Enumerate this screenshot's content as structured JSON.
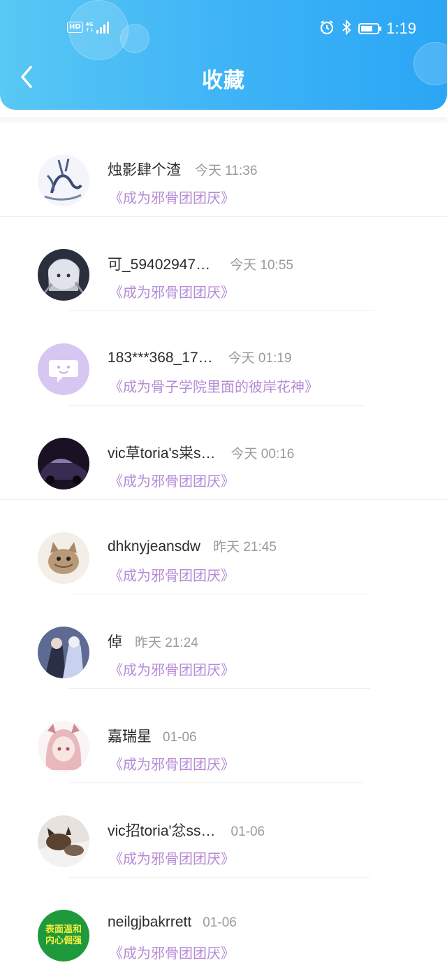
{
  "status_bar": {
    "hd": "HD",
    "network": "4G",
    "time": "1:19",
    "battery_level": 0.7,
    "icons": [
      "alarm-icon",
      "bluetooth-icon",
      "battery-icon"
    ]
  },
  "header": {
    "title": "收藏",
    "back_icon": "chevron-left-icon"
  },
  "colors": {
    "header_start": "#58c8f4",
    "header_end": "#2aa6f5",
    "book_title": "#b48ad6",
    "name": "#2b2b2b",
    "time": "#9a9a9a"
  },
  "favorites": [
    {
      "name": "烛影肆个渣",
      "time": "今天 11:36",
      "book": "《成为邪骨团团厌》",
      "avatar": "sketch-avatar"
    },
    {
      "name": "可_59402947…",
      "time": "今天 10:55",
      "book": "《成为邪骨团团厌》",
      "avatar": "anime-girl-avatar"
    },
    {
      "name": "183***368_17…",
      "time": "今天 01:19",
      "book": "《成为骨子学院里面的彼岸花神》",
      "avatar": "default-chat-avatar"
    },
    {
      "name": "vic草toria's粜s…",
      "time": "今天 00:16",
      "book": "《成为邪骨团团厌》",
      "avatar": "car-avatar"
    },
    {
      "name": "dhknyjeansdw",
      "time": "昨天 21:45",
      "book": "《成为邪骨团团厌》",
      "avatar": "kitten-avatar"
    },
    {
      "name": "倬",
      "time": "昨天 21:24",
      "book": "《成为邪骨团团厌》",
      "avatar": "anime-couple-avatar"
    },
    {
      "name": "嘉瑞星",
      "time": "01-06",
      "book": "《成为邪骨团团厌》",
      "avatar": "pink-hair-avatar"
    },
    {
      "name": "vic招toria'忿ss…",
      "time": "01-06",
      "book": "《成为邪骨团团厌》",
      "avatar": "cat-photo-avatar"
    },
    {
      "name": "neilgjbakrrett",
      "time": "01-06",
      "book": "《成为邪骨团团厌》",
      "avatar": "text-badge-avatar",
      "avatar_text": [
        "表面温和",
        "内心倔强"
      ]
    }
  ]
}
